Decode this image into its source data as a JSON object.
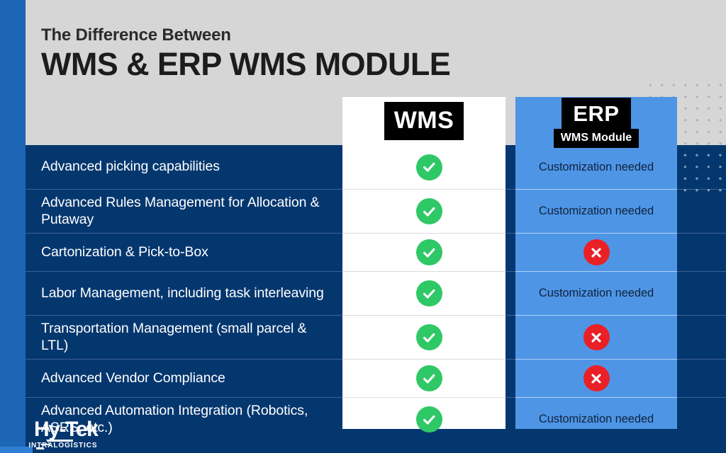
{
  "heading": {
    "kicker": "The Difference Between",
    "title": "WMS & ERP WMS MODULE"
  },
  "columns": {
    "wms": {
      "badge": "WMS"
    },
    "erp": {
      "badge_top": "ERP",
      "badge_sub": "WMS Module"
    }
  },
  "rows": [
    {
      "label": "Advanced picking capabilities",
      "wms": "check",
      "erp_type": "text",
      "erp_text": "Customization needed"
    },
    {
      "label": "Advanced Rules Management for Allocation & Putaway",
      "wms": "check",
      "erp_type": "text",
      "erp_text": "Customization needed"
    },
    {
      "label": "Cartonization & Pick-to-Box",
      "wms": "check",
      "erp_type": "icon",
      "erp_text": ""
    },
    {
      "label": "Labor Management, including task interleaving",
      "wms": "check",
      "erp_type": "text",
      "erp_text": "Customization needed"
    },
    {
      "label": "Transportation Management (small parcel & LTL)",
      "wms": "check",
      "erp_type": "icon",
      "erp_text": ""
    },
    {
      "label": "Advanced Vendor Compliance",
      "wms": "check",
      "erp_type": "icon",
      "erp_text": ""
    },
    {
      "label": "Advanced Automation Integration (Robotics, ASRS, etc.)",
      "wms": "check",
      "erp_type": "text",
      "erp_text": "Customization needed"
    }
  ],
  "logo": {
    "main": "Hy-Tek",
    "sub": "INTRALOGISTICS"
  },
  "colors": {
    "left_stripe": "#1d65b5",
    "header_band": "#d6d6d6",
    "table_band": "#05376f",
    "erp_column": "#4e95e6",
    "wms_column": "#ffffff",
    "check_green": "#2fc866",
    "x_red": "#ea2027",
    "badge_black": "#000000"
  }
}
